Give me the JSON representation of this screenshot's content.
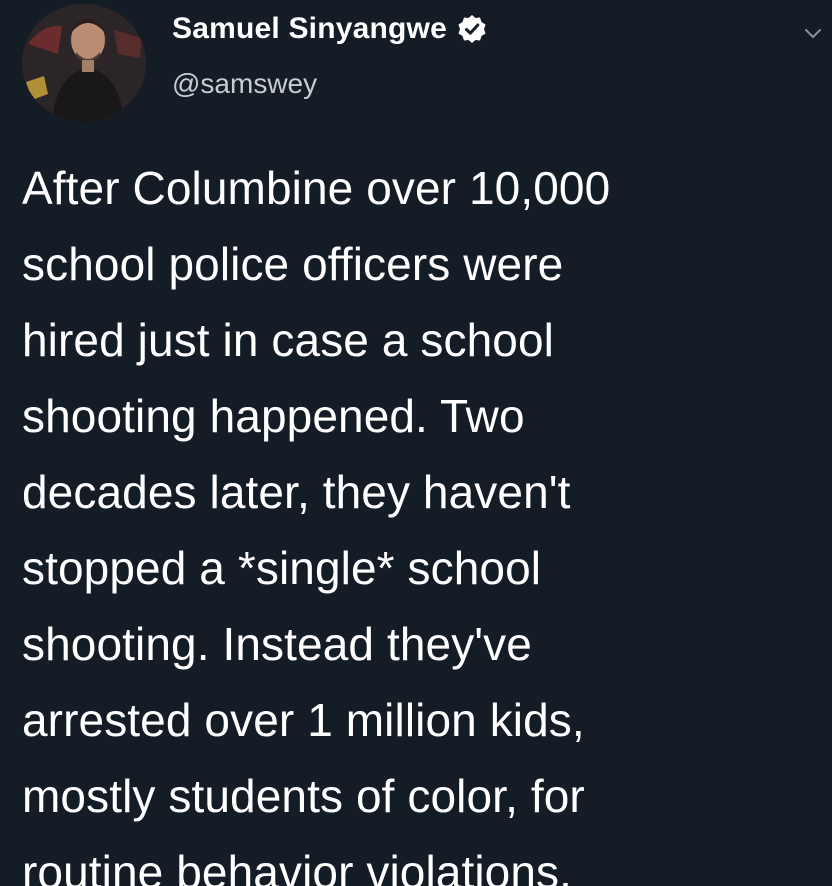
{
  "user": {
    "display_name": "Samuel Sinyangwe",
    "handle": "@samswey",
    "verified": true
  },
  "icons": {
    "verified": "verified-badge-icon",
    "menu": "chevron-down-icon"
  },
  "tweet": {
    "lines": [
      "After Columbine over 10,000",
      "school police officers were",
      "hired just in case a school",
      "shooting happened. Two",
      "decades later, they haven't",
      "stopped a *single* school",
      "shooting. Instead they've",
      "arrested over 1 million kids,",
      "mostly students of color, for",
      "routine behavior violations."
    ]
  },
  "colors": {
    "background": "#141c26",
    "text": "#ffffff",
    "handle": "#c7ccd2"
  }
}
